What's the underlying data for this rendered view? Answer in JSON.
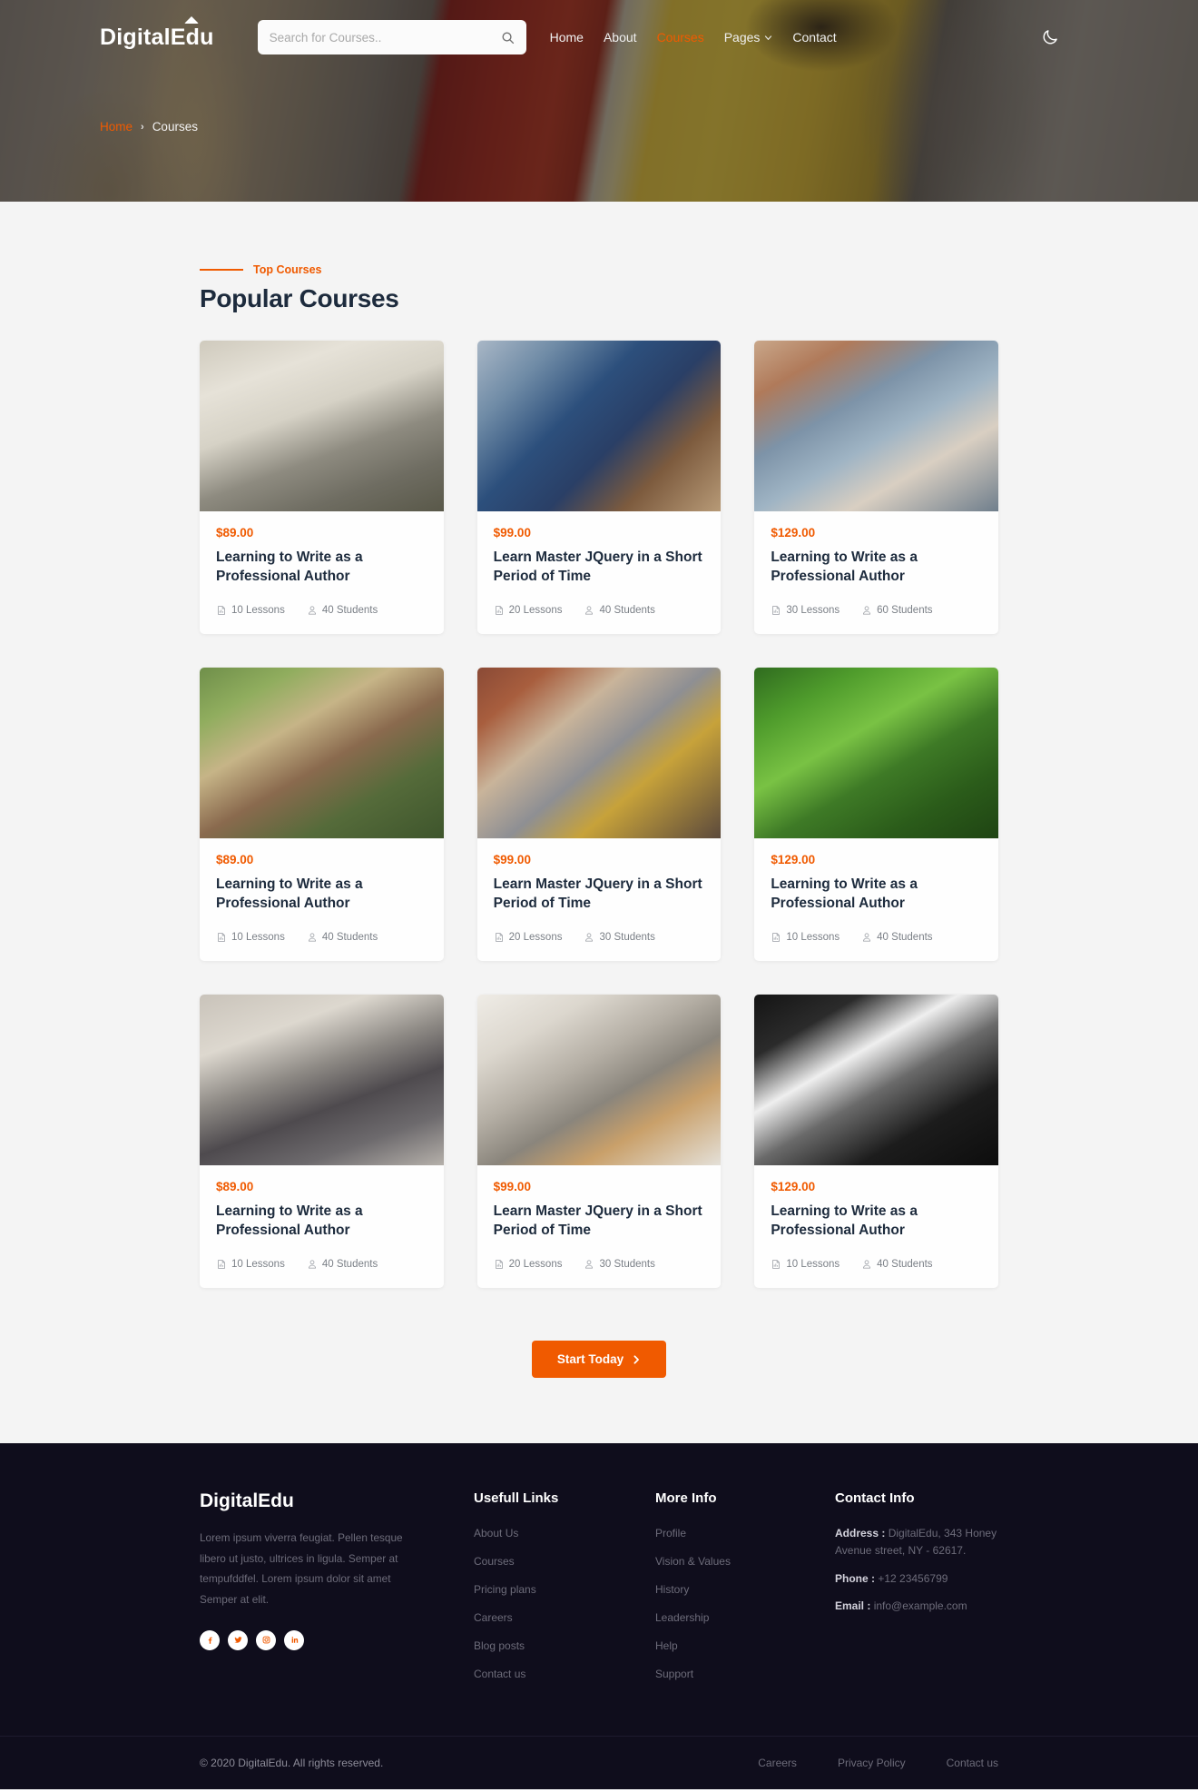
{
  "header": {
    "brand": "DigitalEdu",
    "search": {
      "placeholder": "Search for Courses..",
      "value": ""
    },
    "nav": [
      {
        "label": "Home",
        "active": false,
        "caret": false
      },
      {
        "label": "About",
        "active": false,
        "caret": false
      },
      {
        "label": "Courses",
        "active": true,
        "caret": false
      },
      {
        "label": "Pages",
        "active": false,
        "caret": true
      },
      {
        "label": "Contact",
        "active": false,
        "caret": false
      }
    ],
    "theme_toggle_icon": "moon-icon"
  },
  "breadcrumb": {
    "home": "Home",
    "separator": "›",
    "current": "Courses"
  },
  "section": {
    "eyebrow": "Top Courses",
    "title": "Popular Courses",
    "cta": {
      "label": "Start Today",
      "icon": "chevron-right-icon"
    }
  },
  "courses": [
    {
      "price": "$89.00",
      "title": "Learning to Write as a Professional Author",
      "lessons": "10 Lessons",
      "students": "40 Students",
      "image": "woman-at-desk-with-laptop-and-art-supplies"
    },
    {
      "price": "$99.00",
      "title": "Learn Master JQuery in a Short Period of Time",
      "lessons": "20 Lessons",
      "students": "40 Students",
      "image": "two-students-studying-at-table"
    },
    {
      "price": "$129.00",
      "title": "Learning to Write as a Professional Author",
      "lessons": "30 Lessons",
      "students": "60 Students",
      "image": "person-reading-book-outdoors"
    },
    {
      "price": "$89.00",
      "title": "Learning to Write as a Professional Author",
      "lessons": "10 Lessons",
      "students": "40 Students",
      "image": "smiling-student-with-laptop-outdoors"
    },
    {
      "price": "$99.00",
      "title": "Learn Master JQuery in a Short Period of Time",
      "lessons": "20 Lessons",
      "students": "30 Students",
      "image": "group-of-students-walking-on-street"
    },
    {
      "price": "$129.00",
      "title": "Learning to Write as a Professional Author",
      "lessons": "10 Lessons",
      "students": "40 Students",
      "image": "laptop-on-green-table-in-garden"
    },
    {
      "price": "$89.00",
      "title": "Learning to Write as a Professional Author",
      "lessons": "10 Lessons",
      "students": "40 Students",
      "image": "group-sitting-on-floor-with-papers"
    },
    {
      "price": "$99.00",
      "title": "Learn Master JQuery in a Short Period of Time",
      "lessons": "20 Lessons",
      "students": "30 Students",
      "image": "desk-with-laptop-coffee-and-notebook"
    },
    {
      "price": "$129.00",
      "title": "Learning to Write as a Professional Author",
      "lessons": "10 Lessons",
      "students": "40 Students",
      "image": "dark-workspace-with-monitor-and-lamp"
    }
  ],
  "footer": {
    "brand": "DigitalEdu",
    "about": "Lorem ipsum viverra feugiat. Pellen tesque libero ut justo, ultrices in ligula. Semper at tempufddfel. Lorem ipsum dolor sit amet Semper at elit.",
    "socials": [
      {
        "name": "facebook-icon",
        "label": "f"
      },
      {
        "name": "twitter-icon",
        "label": "t"
      },
      {
        "name": "instagram-icon",
        "label": "ig"
      },
      {
        "name": "linkedin-icon",
        "label": "in"
      }
    ],
    "columns": [
      {
        "heading": "Usefull Links",
        "links": [
          "About Us",
          "Courses",
          "Pricing plans",
          "Careers",
          "Blog posts",
          "Contact us"
        ]
      },
      {
        "heading": "More Info",
        "links": [
          "Profile",
          "Vision & Values",
          "History",
          "Leadership",
          "Help",
          "Support"
        ]
      }
    ],
    "contact": {
      "heading": "Contact Info",
      "address_label": "Address :",
      "address_value": " DigitalEdu, 343 Honey Avenue street, NY - 62617.",
      "phone_label": "Phone :",
      "phone_value": " +12 23456799",
      "email_label": "Email :",
      "email_value": " info@example.com"
    },
    "copyright": "© 2020 DigitalEdu. All rights reserved.",
    "bottom_links": [
      "Careers",
      "Privacy Policy",
      "Contact us"
    ]
  },
  "colors": {
    "accent": "#f05a00",
    "heading": "#1d2b3d",
    "section_bg": "#f4f4f4",
    "footer_bg": "#0f0d1c",
    "muted": "#6d6c7a"
  }
}
